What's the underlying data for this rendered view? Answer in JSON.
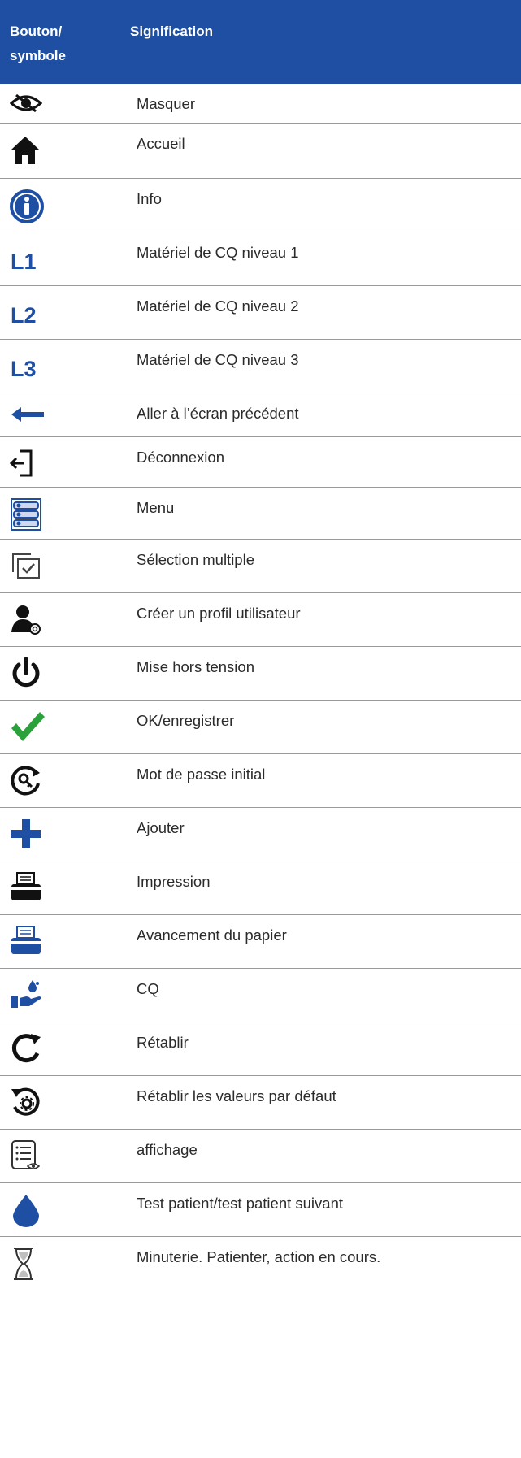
{
  "header": {
    "col1_line1": "Bouton/",
    "col1_line2": "symbole",
    "col2": "Signification"
  },
  "rows": [
    {
      "icon": "hide-eye-icon",
      "label": "Masquer"
    },
    {
      "icon": "home-icon",
      "label": "Accueil"
    },
    {
      "icon": "info-icon",
      "label": "Info"
    },
    {
      "icon": "qc-level-1-icon",
      "label": "Matériel de CQ niveau 1",
      "icon_text": "L1"
    },
    {
      "icon": "qc-level-2-icon",
      "label": "Matériel de CQ niveau 2",
      "icon_text": "L2"
    },
    {
      "icon": "qc-level-3-icon",
      "label": "Matériel de CQ niveau 3",
      "icon_text": "L3"
    },
    {
      "icon": "back-arrow-icon",
      "label": "Aller à l’écran précédent"
    },
    {
      "icon": "logout-icon",
      "label": "Déconnexion"
    },
    {
      "icon": "menu-icon",
      "label": "Menu"
    },
    {
      "icon": "multi-select-icon",
      "label": "Sélection multiple"
    },
    {
      "icon": "create-user-icon",
      "label": "Créer un profil utilisateur"
    },
    {
      "icon": "power-icon",
      "label": "Mise hors tension"
    },
    {
      "icon": "checkmark-icon",
      "label": "OK/enregistrer"
    },
    {
      "icon": "initial-password-icon",
      "label": "Mot de passe initial"
    },
    {
      "icon": "plus-icon",
      "label": "Ajouter"
    },
    {
      "icon": "printer-icon",
      "label": "Impression"
    },
    {
      "icon": "paper-feed-icon",
      "label": "Avancement du papier"
    },
    {
      "icon": "qc-drop-hand-icon",
      "label": "CQ"
    },
    {
      "icon": "reset-icon",
      "label": "Rétablir"
    },
    {
      "icon": "restore-defaults-icon",
      "label": "Rétablir les valeurs par défaut"
    },
    {
      "icon": "view-list-icon",
      "label": "affichage"
    },
    {
      "icon": "patient-drop-icon",
      "label": "Test patient/test patient suivant"
    },
    {
      "icon": "hourglass-icon",
      "label": "Minuterie. Patienter, action en cours."
    }
  ],
  "colors": {
    "header_bg": "#1f4fa3",
    "icon_blue": "#1f4fa3",
    "check_green": "#2aa13a",
    "divider": "#9a9a9a"
  }
}
